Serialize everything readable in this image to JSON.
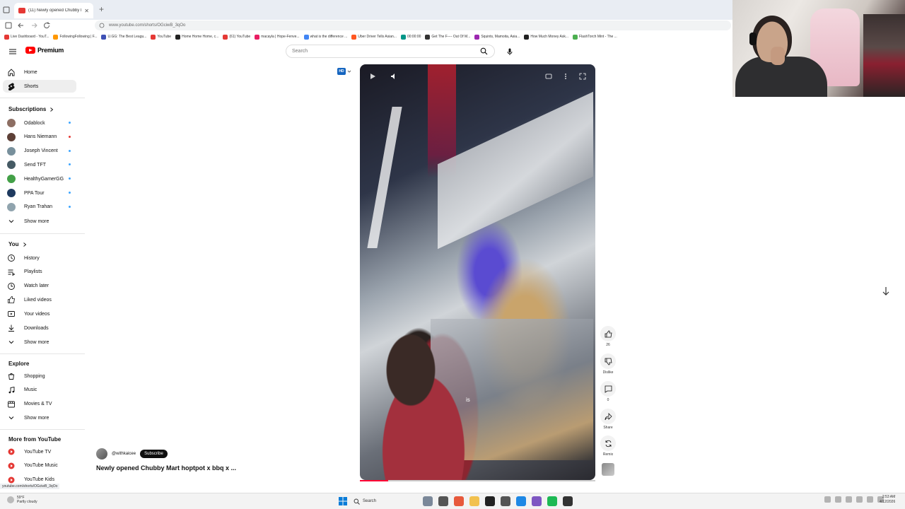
{
  "browser": {
    "tab_title": "(11) Newly opened Chubby Ma",
    "new_tab": "+",
    "url": "www.youtube.com/shorts/OGciwB_3qOo",
    "bookmarks": [
      {
        "label": "Live Dashboard - YouT...",
        "color": "#e53935"
      },
      {
        "label": "FollowingFollowing | F...",
        "color": "#ff9800"
      },
      {
        "label": "U.GG: The Best Leagu...",
        "color": "#3f51b5"
      },
      {
        "label": "YouTube",
        "color": "#e53935"
      },
      {
        "label": "Home Home Home, c...",
        "color": "#222222"
      },
      {
        "label": "(61) YouTube",
        "color": "#e53935"
      },
      {
        "label": "macayla | Hope-Fenve...",
        "color": "#e91e63"
      },
      {
        "label": "what is the difference ...",
        "color": "#4285f4"
      },
      {
        "label": "Uber Driver Tells Asian...",
        "color": "#ff5722"
      },
      {
        "label": "00:00:00",
        "color": "#009688"
      },
      {
        "label": "Get The F---- Out Of M...",
        "color": "#333333"
      },
      {
        "label": "Squints, Mamoita, Asia...",
        "color": "#9c27b0"
      },
      {
        "label": "How Much Money Ask...",
        "color": "#222222"
      },
      {
        "label": "FlashTorch Mint - The ...",
        "color": "#4caf50"
      }
    ],
    "status_url": "youtube.com/shorts/OGciwB_3qOo"
  },
  "header": {
    "brand": "Premium",
    "search_placeholder": "Search"
  },
  "sidebar": {
    "top": [
      {
        "label": "Home",
        "icon": "home-icon"
      },
      {
        "label": "Shorts",
        "icon": "shorts-icon"
      }
    ],
    "subscriptions_heading": "Subscriptions",
    "subscriptions": [
      {
        "label": "Odablock",
        "color": "#8d6e63"
      },
      {
        "label": "Hans Niemann",
        "color": "#5d4037"
      },
      {
        "label": "Joseph Vincent",
        "color": "#78909c"
      },
      {
        "label": "Send TFT",
        "color": "#455a64"
      },
      {
        "label": "HealthyGamerGG",
        "color": "#43a047"
      },
      {
        "label": "PPA Tour",
        "color": "#1e3a5f"
      },
      {
        "label": "Ryan Trahan",
        "color": "#90a4ae"
      }
    ],
    "show_more": "Show more",
    "you_heading": "You",
    "you": [
      {
        "label": "History",
        "icon": "history-icon"
      },
      {
        "label": "Playlists",
        "icon": "playlists-icon"
      },
      {
        "label": "Watch later",
        "icon": "clock-icon"
      },
      {
        "label": "Liked videos",
        "icon": "thumbs-up-icon"
      },
      {
        "label": "Your videos",
        "icon": "video-icon"
      },
      {
        "label": "Downloads",
        "icon": "download-icon"
      }
    ],
    "explore_heading": "Explore",
    "explore": [
      {
        "label": "Shopping",
        "icon": "bag-icon"
      },
      {
        "label": "Music",
        "icon": "music-icon"
      },
      {
        "label": "Movies & TV",
        "icon": "film-icon"
      }
    ],
    "more_heading": "More from YouTube",
    "more": [
      {
        "label": "YouTube TV"
      },
      {
        "label": "YouTube Music"
      },
      {
        "label": "YouTube Kids"
      }
    ]
  },
  "video": {
    "hd_badge": "HD",
    "caption": "is",
    "progress": 0.12,
    "channel": "@withkaicee",
    "subscribe": "Subscribe",
    "title": "Newly opened Chubby Mart hoptpot x bbq x ..."
  },
  "actions": {
    "like_count": "26",
    "dislike": "Dislike",
    "comments": "0",
    "share": "Share",
    "remix": "Remix"
  },
  "taskbar": {
    "weather_temp": "59°F",
    "weather_desc": "Partly cloudy",
    "search": "Search",
    "time": "2:53 AM",
    "date": "4/12/2026"
  }
}
